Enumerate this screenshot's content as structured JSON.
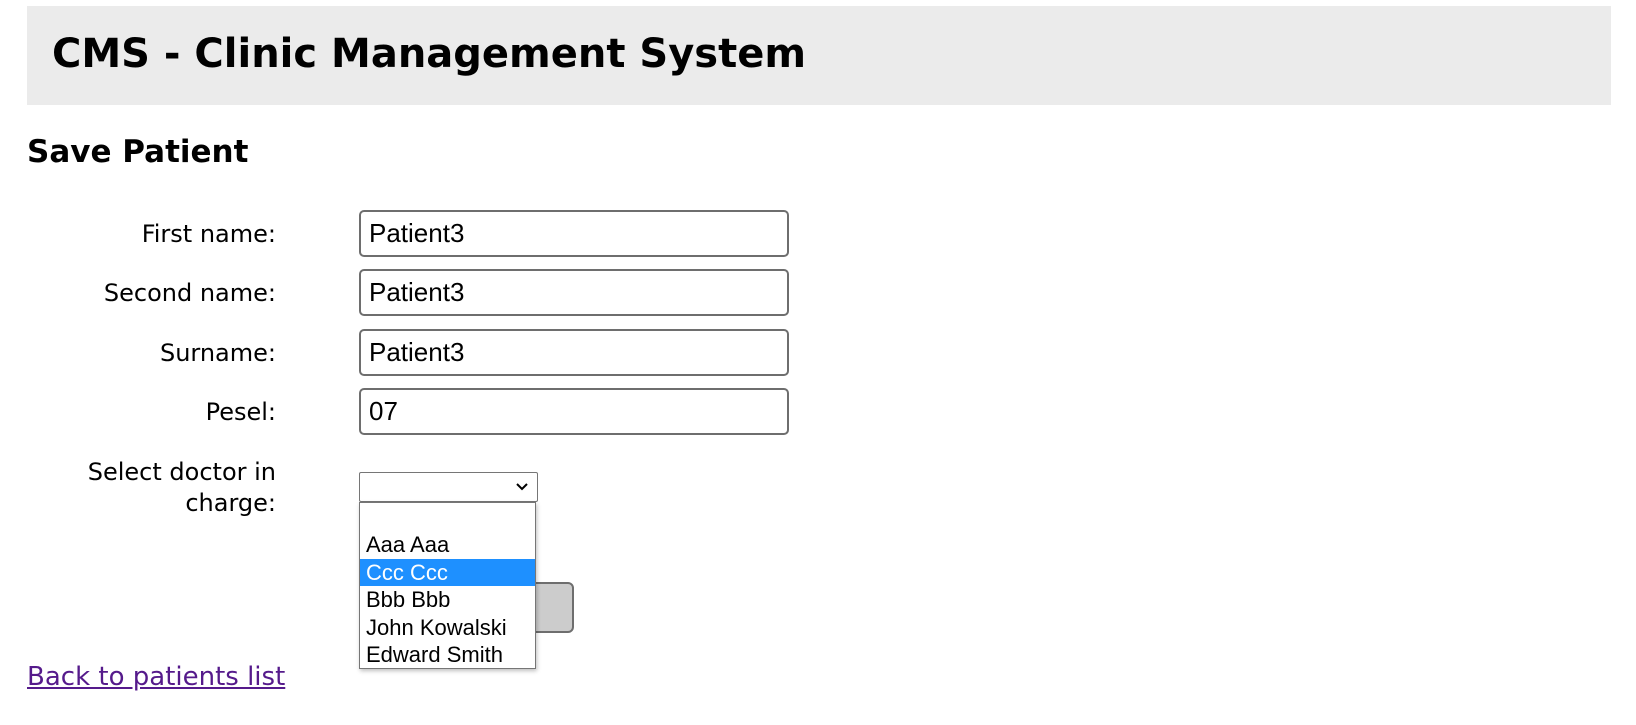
{
  "header": {
    "title": "CMS - Clinic Management System"
  },
  "page": {
    "title": "Save Patient"
  },
  "form": {
    "first_name": {
      "label": "First name:",
      "value": "Patient3"
    },
    "second_name": {
      "label": "Second name:",
      "value": "Patient3"
    },
    "surname": {
      "label": "Surname:",
      "value": "Patient3"
    },
    "pesel": {
      "label": "Pesel:",
      "value": "07"
    },
    "doctor": {
      "label_line1": "Select doctor in",
      "label_line2": "charge:",
      "selected_value": "",
      "options": [
        "",
        "Aaa Aaa",
        "Ccc Ccc",
        "Bbb Bbb",
        "John Kowalski",
        "Edward Smith"
      ],
      "highlighted_option": "Ccc Ccc"
    },
    "submit_label": ""
  },
  "links": {
    "back_label": "Back to patients list"
  },
  "colors": {
    "header_bg": "#ebebeb",
    "highlight": "#1e90ff",
    "link": "#551a8b",
    "button_bg": "#cccccc"
  },
  "icons": {
    "select_arrow": "chevron-down-icon"
  }
}
